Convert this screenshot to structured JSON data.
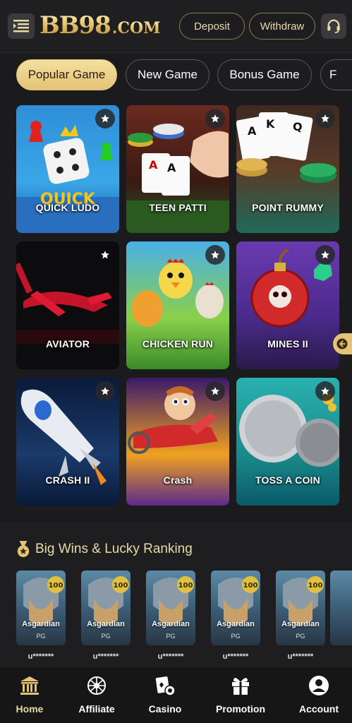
{
  "header": {
    "logo_text": "BB98",
    "logo_suffix": ".COM",
    "deposit_label": "Deposit",
    "withdraw_label": "Withdraw"
  },
  "tabs": [
    {
      "label": "Popular Game",
      "active": true
    },
    {
      "label": "New Game",
      "active": false
    },
    {
      "label": "Bonus Game",
      "active": false
    },
    {
      "label": "F",
      "active": false
    }
  ],
  "games": [
    {
      "name": "QUICK LUDO"
    },
    {
      "name": "TEEN PATTI"
    },
    {
      "name": "POINT RUMMY"
    },
    {
      "name": "AVIATOR"
    },
    {
      "name": "CHICKEN RUN"
    },
    {
      "name": "MINES II"
    },
    {
      "name": "CRASH II"
    },
    {
      "name": "Crash"
    },
    {
      "name": "TOSS A COIN"
    }
  ],
  "wins": {
    "title": "Big Wins & Lucky Ranking",
    "items": [
      {
        "game": "Asgardian",
        "provider": "PG",
        "user": "u*******"
      },
      {
        "game": "Asgardian",
        "provider": "PG",
        "user": "u*******"
      },
      {
        "game": "Asgardian",
        "provider": "PG",
        "user": "u*******"
      },
      {
        "game": "Asgardian",
        "provider": "PG",
        "user": "u*******"
      },
      {
        "game": "Asgardian",
        "provider": "PG",
        "user": "u*******"
      }
    ]
  },
  "nav": [
    {
      "label": "Home",
      "icon": "home-icon",
      "active": true
    },
    {
      "label": "Affiliate",
      "icon": "affiliate-icon",
      "active": false
    },
    {
      "label": "Casino",
      "icon": "casino-icon",
      "active": false
    },
    {
      "label": "Promotion",
      "icon": "promotion-icon",
      "active": false
    },
    {
      "label": "Account",
      "icon": "account-icon",
      "active": false
    }
  ],
  "colors": {
    "accent_gold": "#e3c376",
    "background": "#1b1b1d"
  }
}
